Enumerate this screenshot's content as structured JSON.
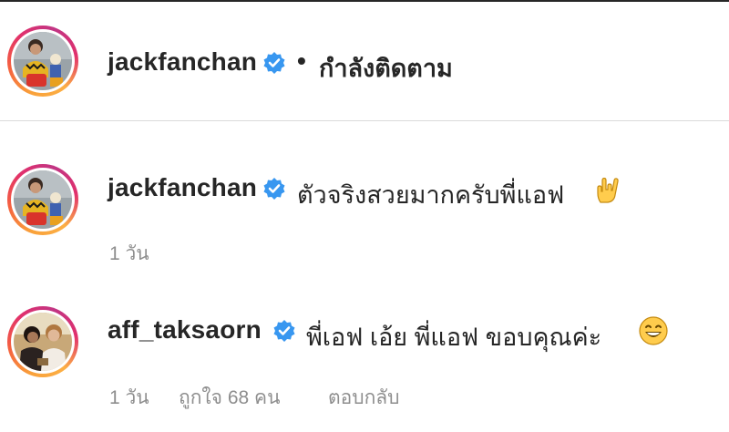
{
  "post_header": {
    "username": "jackfanchan",
    "separator": "•",
    "follow_status": "กำลังติดตาม",
    "verified_icon": "verified-badge-icon"
  },
  "comments": [
    {
      "username": "jackfanchan",
      "text": "ตัวจริงสวยมากครับพี่แอฟ",
      "emoji": "love-you-gesture-emoji",
      "time": "1 วัน"
    },
    {
      "username": "aff_taksaorn",
      "text": "พี่เอฟ เอ้ย พี่แอฟ ขอบคุณค่ะ",
      "emoji": "grinning-face-emoji",
      "time": "1 วัน",
      "likes": "ถูกใจ 68 คน",
      "reply_label": "ตอบกลับ"
    }
  ],
  "colors": {
    "verified_blue": "#3897f0",
    "text_primary": "#262626",
    "text_secondary": "#8e8e8e",
    "divider": "#dbdbdb"
  }
}
